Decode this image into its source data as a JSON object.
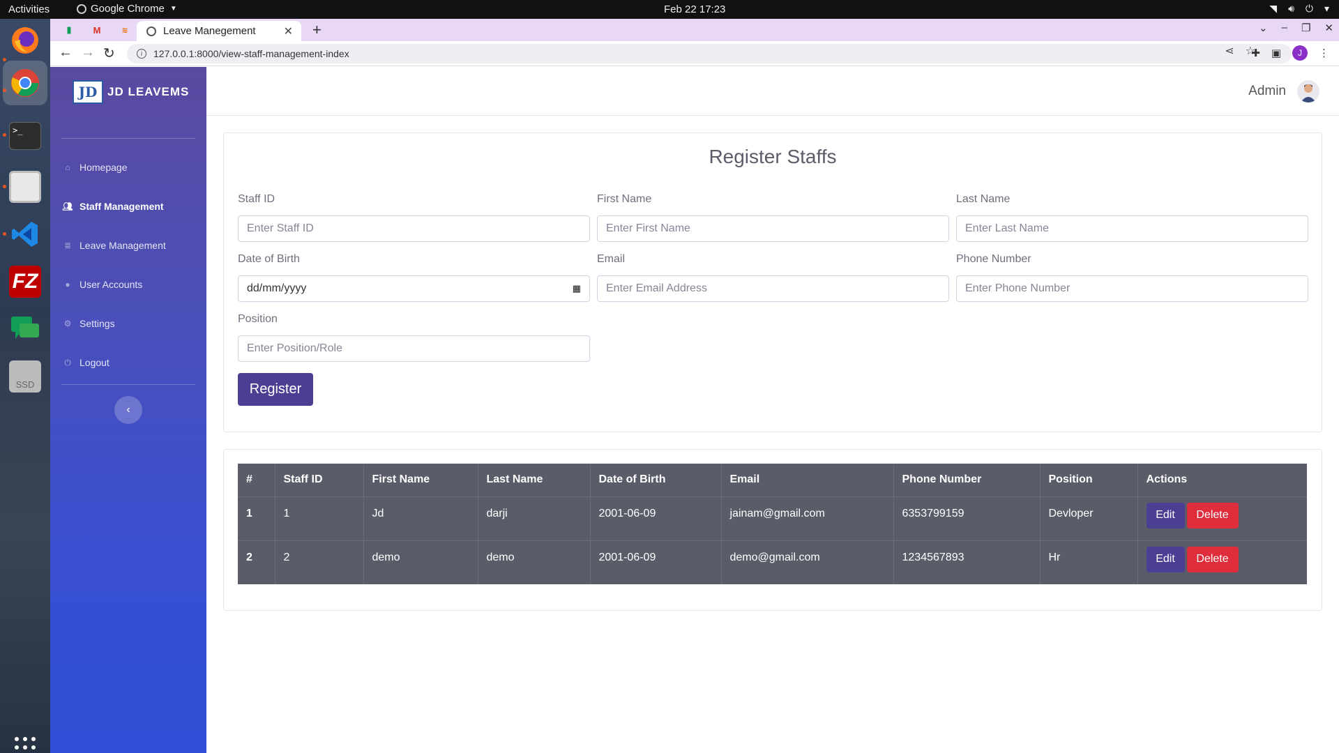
{
  "system": {
    "activities": "Activities",
    "app_name": "Google Chrome",
    "clock": "Feb 22  17:23"
  },
  "dock": {
    "apps": [
      "firefox-icon",
      "chrome-icon",
      "terminal-icon",
      "files-icon",
      "vscode-icon",
      "filezilla-icon",
      "chat-icon",
      "ssd-drive-icon"
    ],
    "ssd_label": "SSD"
  },
  "browser": {
    "tab_title": "Leave Manegement",
    "url": "127.0.0.1:8000/view-staff-management-index",
    "profile_initial": "J",
    "pinned_tabs": [
      "sheets-icon",
      "gmail-icon",
      "phpmyadmin-icon"
    ]
  },
  "app": {
    "brand_logo_text": "JD",
    "brand_name": "JD LEAVEMS",
    "nav": [
      {
        "label": "Homepage",
        "icon": "home-icon",
        "active": false
      },
      {
        "label": "Staff Management",
        "icon": "users-icon",
        "active": true
      },
      {
        "label": "Leave Management",
        "icon": "database-icon",
        "active": false
      },
      {
        "label": "User Accounts",
        "icon": "user-icon",
        "active": false
      },
      {
        "label": "Settings",
        "icon": "gear-icon",
        "active": false
      },
      {
        "label": "Logout",
        "icon": "power-icon",
        "active": false
      }
    ],
    "user_name": "Admin"
  },
  "form": {
    "title": "Register Staffs",
    "staff_id_label": "Staff ID",
    "staff_id_placeholder": "Enter Staff ID",
    "first_name_label": "First Name",
    "first_name_placeholder": "Enter First Name",
    "last_name_label": "Last Name",
    "last_name_placeholder": "Enter Last Name",
    "dob_label": "Date of Birth",
    "dob_value": "dd/mm/yyyy",
    "email_label": "Email",
    "email_placeholder": "Enter Email Address",
    "phone_label": "Phone Number",
    "phone_placeholder": "Enter Phone Number",
    "position_label": "Position",
    "position_placeholder": "Enter Position/Role",
    "register_label": "Register"
  },
  "table": {
    "headers": [
      "#",
      "Staff ID",
      "First Name",
      "Last Name",
      "Date of Birth",
      "Email",
      "Phone Number",
      "Position",
      "Actions"
    ],
    "rows": [
      {
        "num": "1",
        "staff_id": "1",
        "first_name": "Jd",
        "last_name": "darji",
        "dob": "2001-06-09",
        "email": "jainam@gmail.com",
        "phone": "6353799159",
        "position": "Devloper"
      },
      {
        "num": "2",
        "staff_id": "2",
        "first_name": "demo",
        "last_name": "demo",
        "dob": "2001-06-09",
        "email": "demo@gmail.com",
        "phone": "1234567893",
        "position": "Hr"
      }
    ],
    "edit_label": "Edit",
    "delete_label": "Delete"
  },
  "colors": {
    "sidebar_top": "#5a4a9f",
    "sidebar_bottom": "#2e4fd6",
    "primary_button": "#4b3f93",
    "danger_button": "#e02d3c",
    "table_bg": "#5a5c69"
  }
}
